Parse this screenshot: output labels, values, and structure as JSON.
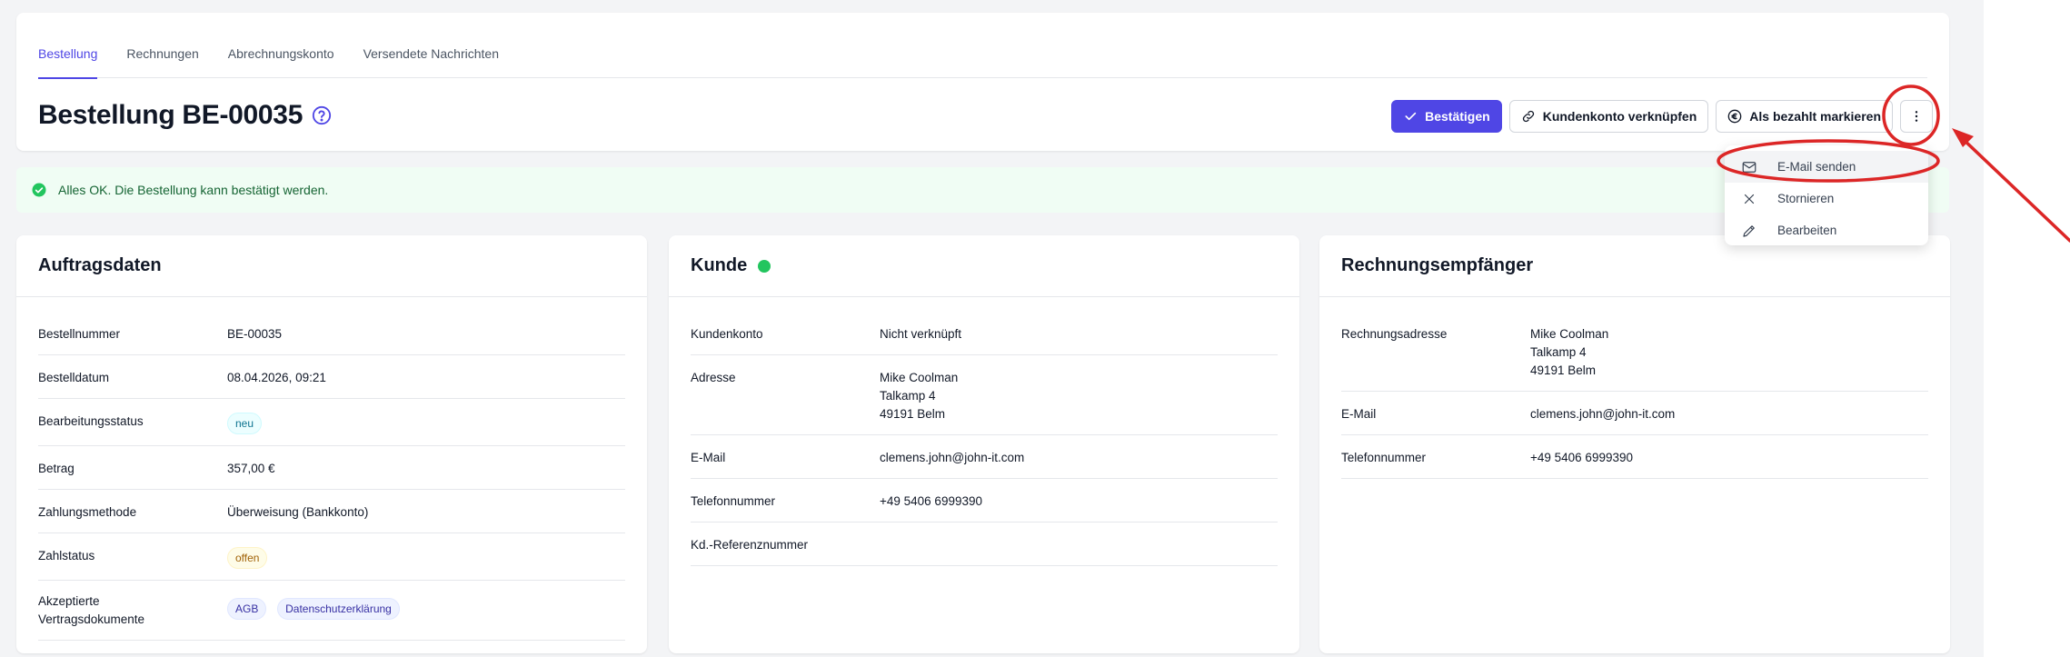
{
  "tabs": [
    {
      "label": "Bestellung",
      "active": true
    },
    {
      "label": "Rechnungen",
      "active": false
    },
    {
      "label": "Abrechnungskonto",
      "active": false
    },
    {
      "label": "Versendete Nachrichten",
      "active": false
    }
  ],
  "header": {
    "title": "Bestellung BE-00035",
    "help_icon": "question-circle-icon"
  },
  "actions": {
    "confirm_label": "Bestätigen",
    "link_account_label": "Kundenkonto verknüpfen",
    "mark_paid_label": "Als bezahlt markieren",
    "more_icon": "vertical-dots-icon"
  },
  "alert": {
    "text": "Alles OK. Die Bestellung kann bestätigt werden."
  },
  "dropdown": {
    "items": [
      {
        "label": "E-Mail senden",
        "icon": "mail-icon"
      },
      {
        "label": "Stornieren",
        "icon": "x-icon"
      },
      {
        "label": "Bearbeiten",
        "icon": "pencil-icon"
      }
    ]
  },
  "order_card": {
    "title": "Auftragsdaten",
    "rows": [
      {
        "label": "Bestellnummer",
        "value": "BE-00035"
      },
      {
        "label": "Bestelldatum",
        "value": "08.04.2026, 09:21"
      },
      {
        "label": "Bearbeitungsstatus",
        "badge": "neu"
      },
      {
        "label": "Betrag",
        "value": "357,00 €"
      },
      {
        "label": "Zahlungsmethode",
        "value": "Überweisung (Bankkonto)"
      },
      {
        "label": "Zahlstatus",
        "badge": "offen"
      },
      {
        "label_line1": "Akzeptierte",
        "label_line2": "Vertragsdokumente",
        "badges": [
          "AGB",
          "Datenschutzerklärung"
        ]
      }
    ]
  },
  "customer_card": {
    "title": "Kunde",
    "status_color": "#22c55e",
    "rows": [
      {
        "label": "Kundenkonto",
        "value": "Nicht verknüpft"
      },
      {
        "label": "Adresse",
        "lines": [
          "Mike Coolman",
          "Talkamp 4",
          "49191 Belm"
        ]
      },
      {
        "label": "E-Mail",
        "value": "clemens.john@john-it.com"
      },
      {
        "label": "Telefonnummer",
        "value": "+49 5406 6999390"
      },
      {
        "label": "Kd.-Referenznummer",
        "value": ""
      }
    ]
  },
  "invoice_card": {
    "title": "Rechnungsempfänger",
    "rows": [
      {
        "label": "Rechnungsadresse",
        "lines": [
          "Mike Coolman",
          "Talkamp 4",
          "49191 Belm"
        ]
      },
      {
        "label": "E-Mail",
        "value": "clemens.john@john-it.com"
      },
      {
        "label": "Telefonnummer",
        "value": "+49 5406 6999390"
      }
    ]
  },
  "colors": {
    "accent": "#4f46e5",
    "success": "#22c55e",
    "annotation": "#dc2626"
  }
}
